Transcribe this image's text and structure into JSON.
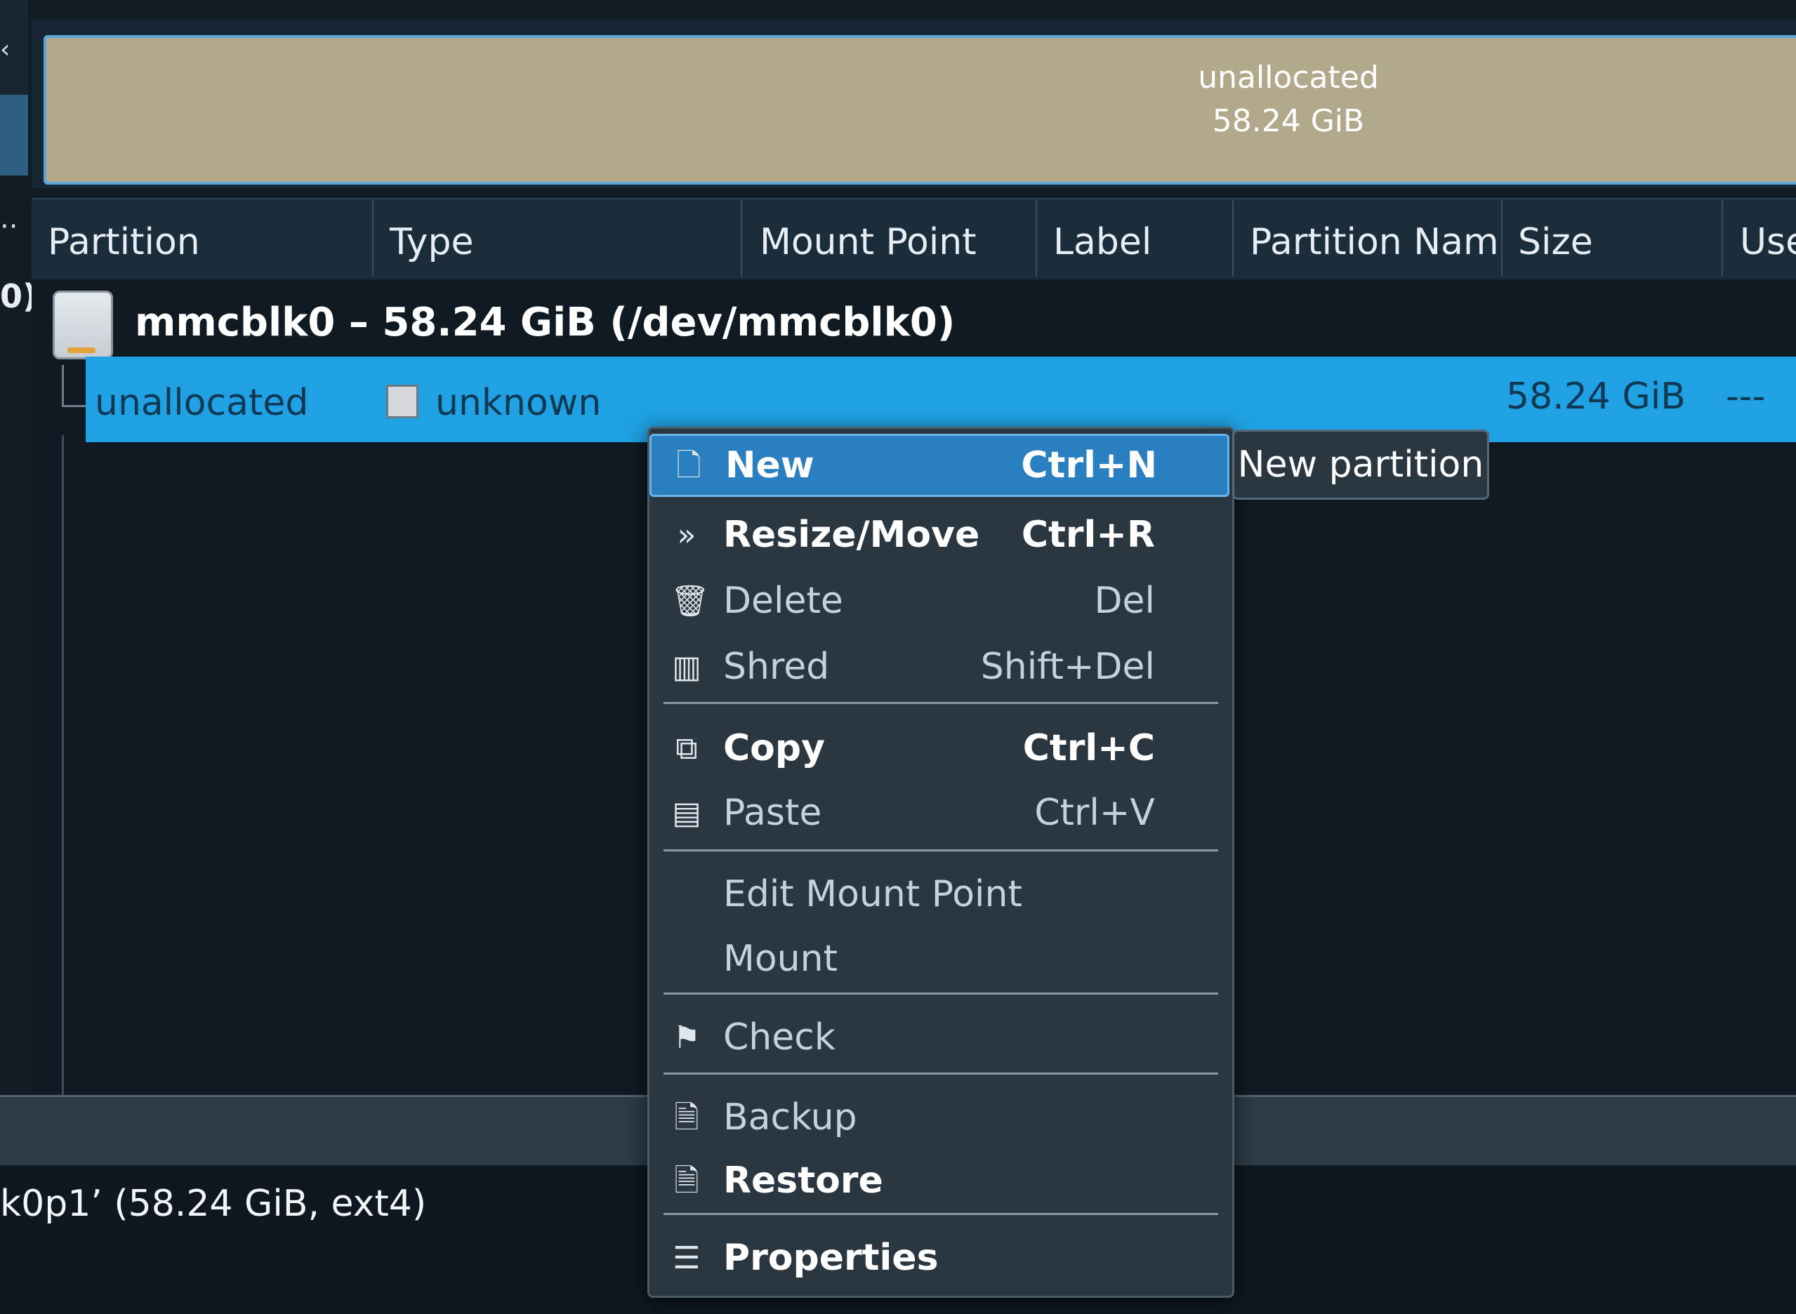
{
  "graphic": {
    "label": "unallocated",
    "size": "58.24 GiB"
  },
  "left": {
    "chevron": "‹",
    "dots": "··",
    "paren": "0)"
  },
  "columns": {
    "partition": "Partition",
    "type": "Type",
    "mount_point": "Mount Point",
    "label": "Label",
    "partition_name": "Partition Nam",
    "size": "Size",
    "used": "Use"
  },
  "device": {
    "title": "mmcblk0 – 58.24 GiB (/dev/mmcblk0)"
  },
  "selected_row": {
    "partition": "unallocated",
    "type": "unknown",
    "size": "58.24 GiB",
    "used": "---"
  },
  "status": {
    "text": "k0p1’ (58.24 GiB, ext4)"
  },
  "menu": {
    "new": {
      "label": "New",
      "shortcut": "Ctrl+N"
    },
    "resize": {
      "label": "Resize/Move",
      "shortcut": "Ctrl+R"
    },
    "delete": {
      "label": "Delete",
      "shortcut": "Del"
    },
    "shred": {
      "label": "Shred",
      "shortcut": "Shift+Del"
    },
    "copy": {
      "label": "Copy",
      "shortcut": "Ctrl+C"
    },
    "paste": {
      "label": "Paste",
      "shortcut": "Ctrl+V"
    },
    "edit_mount": {
      "label": "Edit Mount Point"
    },
    "mount": {
      "label": "Mount"
    },
    "check": {
      "label": "Check"
    },
    "backup": {
      "label": "Backup"
    },
    "restore": {
      "label": "Restore"
    },
    "properties": {
      "label": "Properties"
    }
  },
  "tooltip": {
    "text": "New partition"
  },
  "icons": {
    "new": "new-partition-icon",
    "resize": "double-chevron-icon",
    "delete": "trash-icon",
    "shred": "shredder-icon",
    "copy": "copy-icon",
    "paste": "clipboard-icon",
    "check": "flag-icon",
    "backup": "backup-icon",
    "restore": "restore-icon",
    "properties": "list-icon"
  },
  "colors": {
    "selection": "#1fa1e3",
    "highlight": "#2a7fc0",
    "graphic_fill": "#b2a98c"
  }
}
